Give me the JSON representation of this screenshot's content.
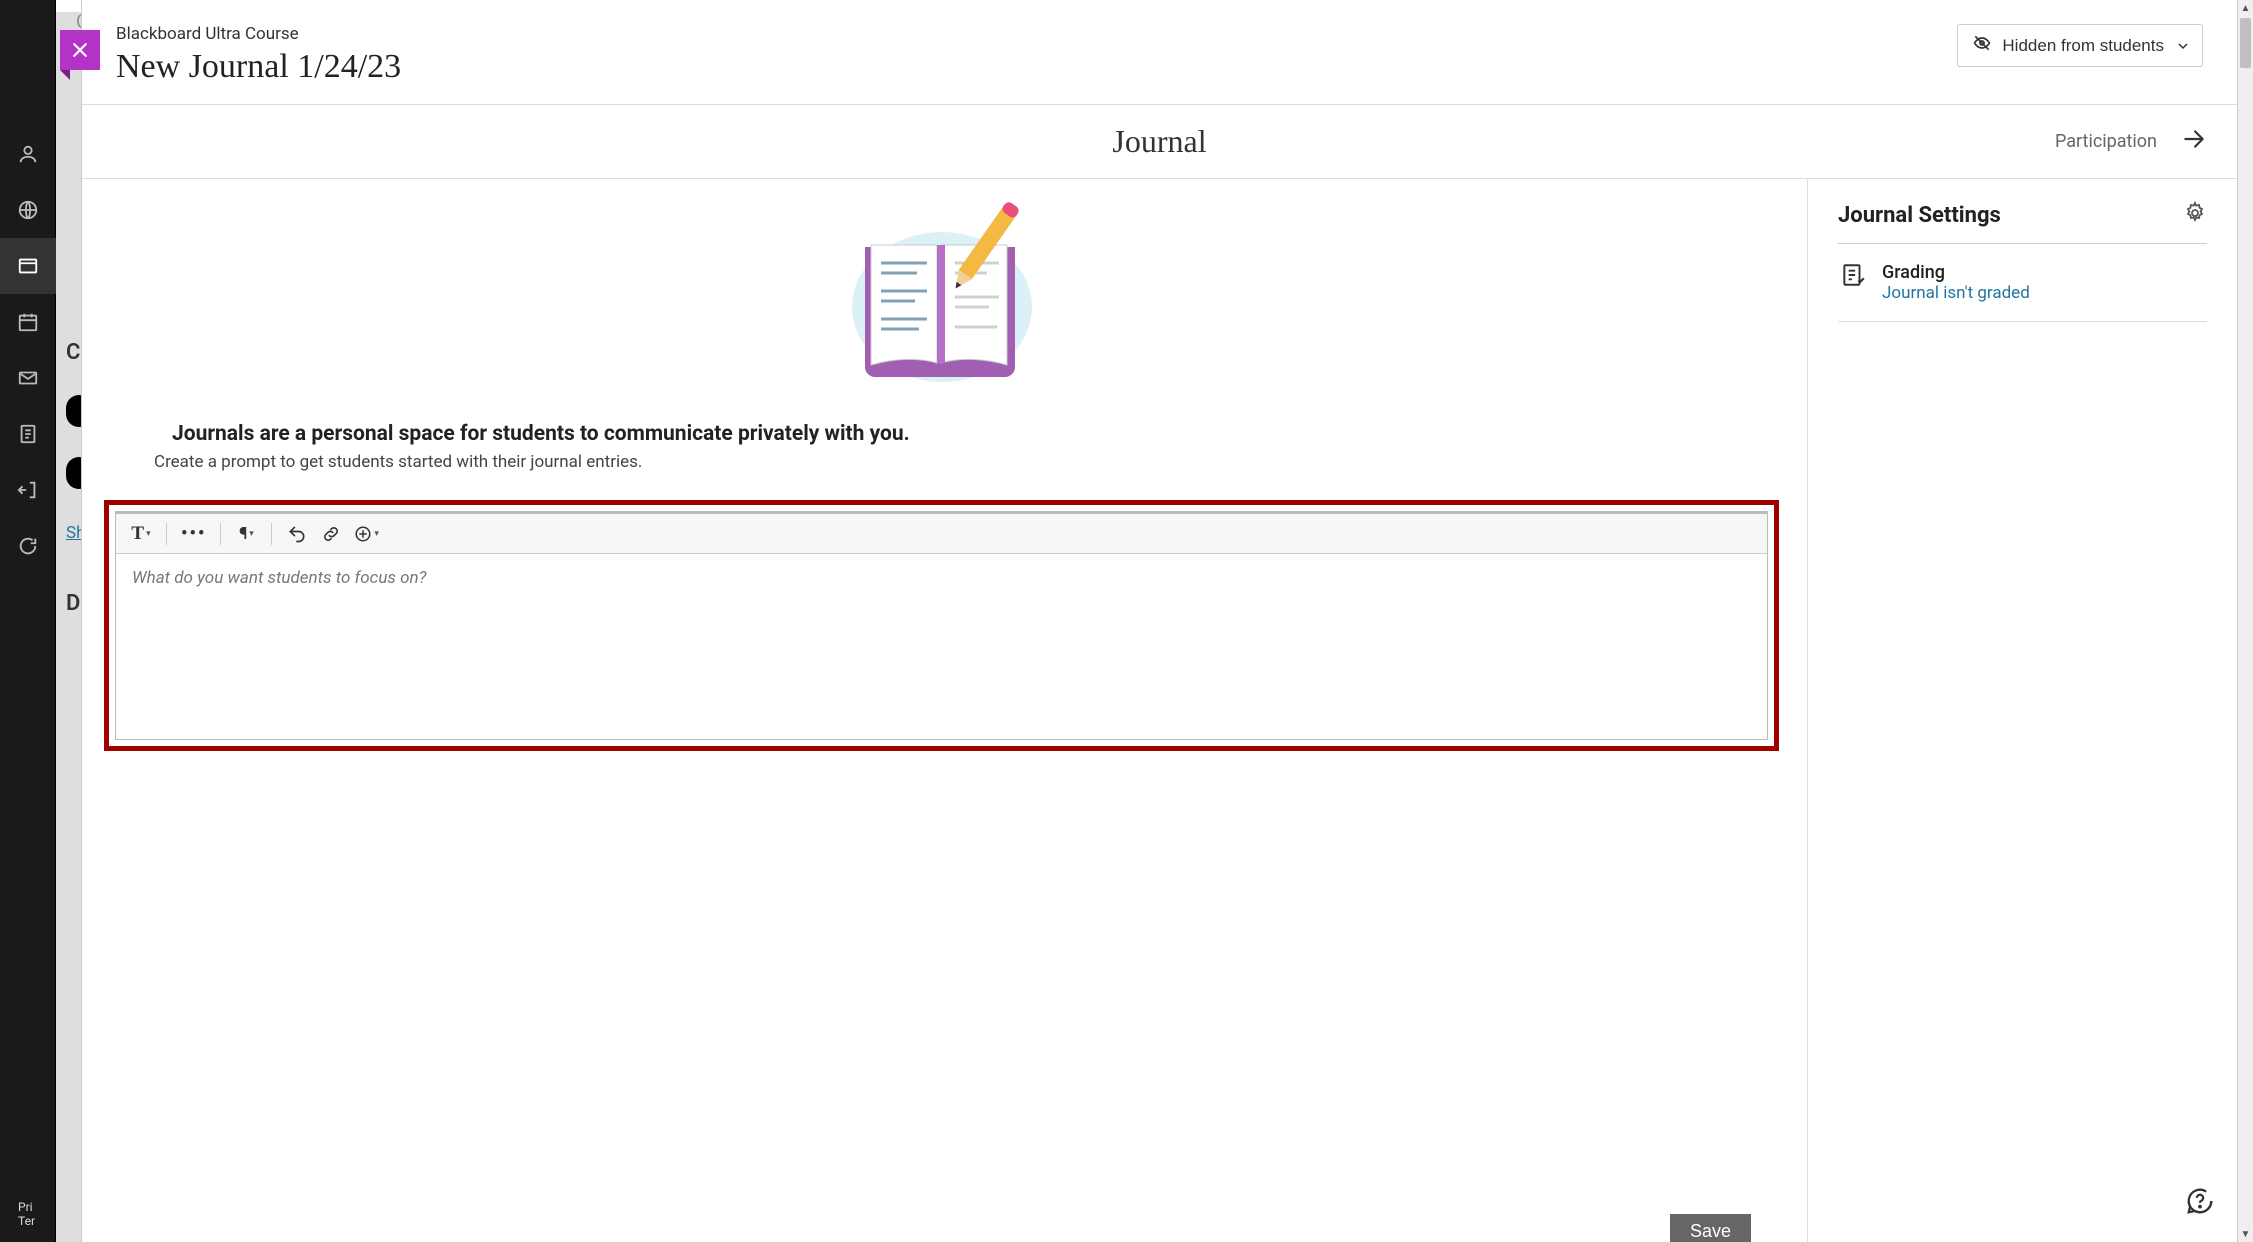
{
  "background": {
    "top_text": "Co",
    "link_sh": "Sh",
    "letter_c": "C",
    "letter_d": "D",
    "footer_priv": "Pri",
    "footer_ter": "Ter"
  },
  "header": {
    "course_name": "Blackboard Ultra Course",
    "title": "New Journal 1/24/23",
    "visibility_label": "Hidden from students"
  },
  "subheader": {
    "center": "Journal",
    "participation": "Participation"
  },
  "main": {
    "intro_heading": "Journals are a personal space for students to communicate privately with you.",
    "intro_sub": "Create a prompt to get students started with their journal entries.",
    "editor_placeholder": "What do you want students to focus on?",
    "save_label": "Save"
  },
  "sidebar": {
    "title": "Journal Settings",
    "grading_label": "Grading",
    "grading_status": "Journal isn't graded"
  }
}
